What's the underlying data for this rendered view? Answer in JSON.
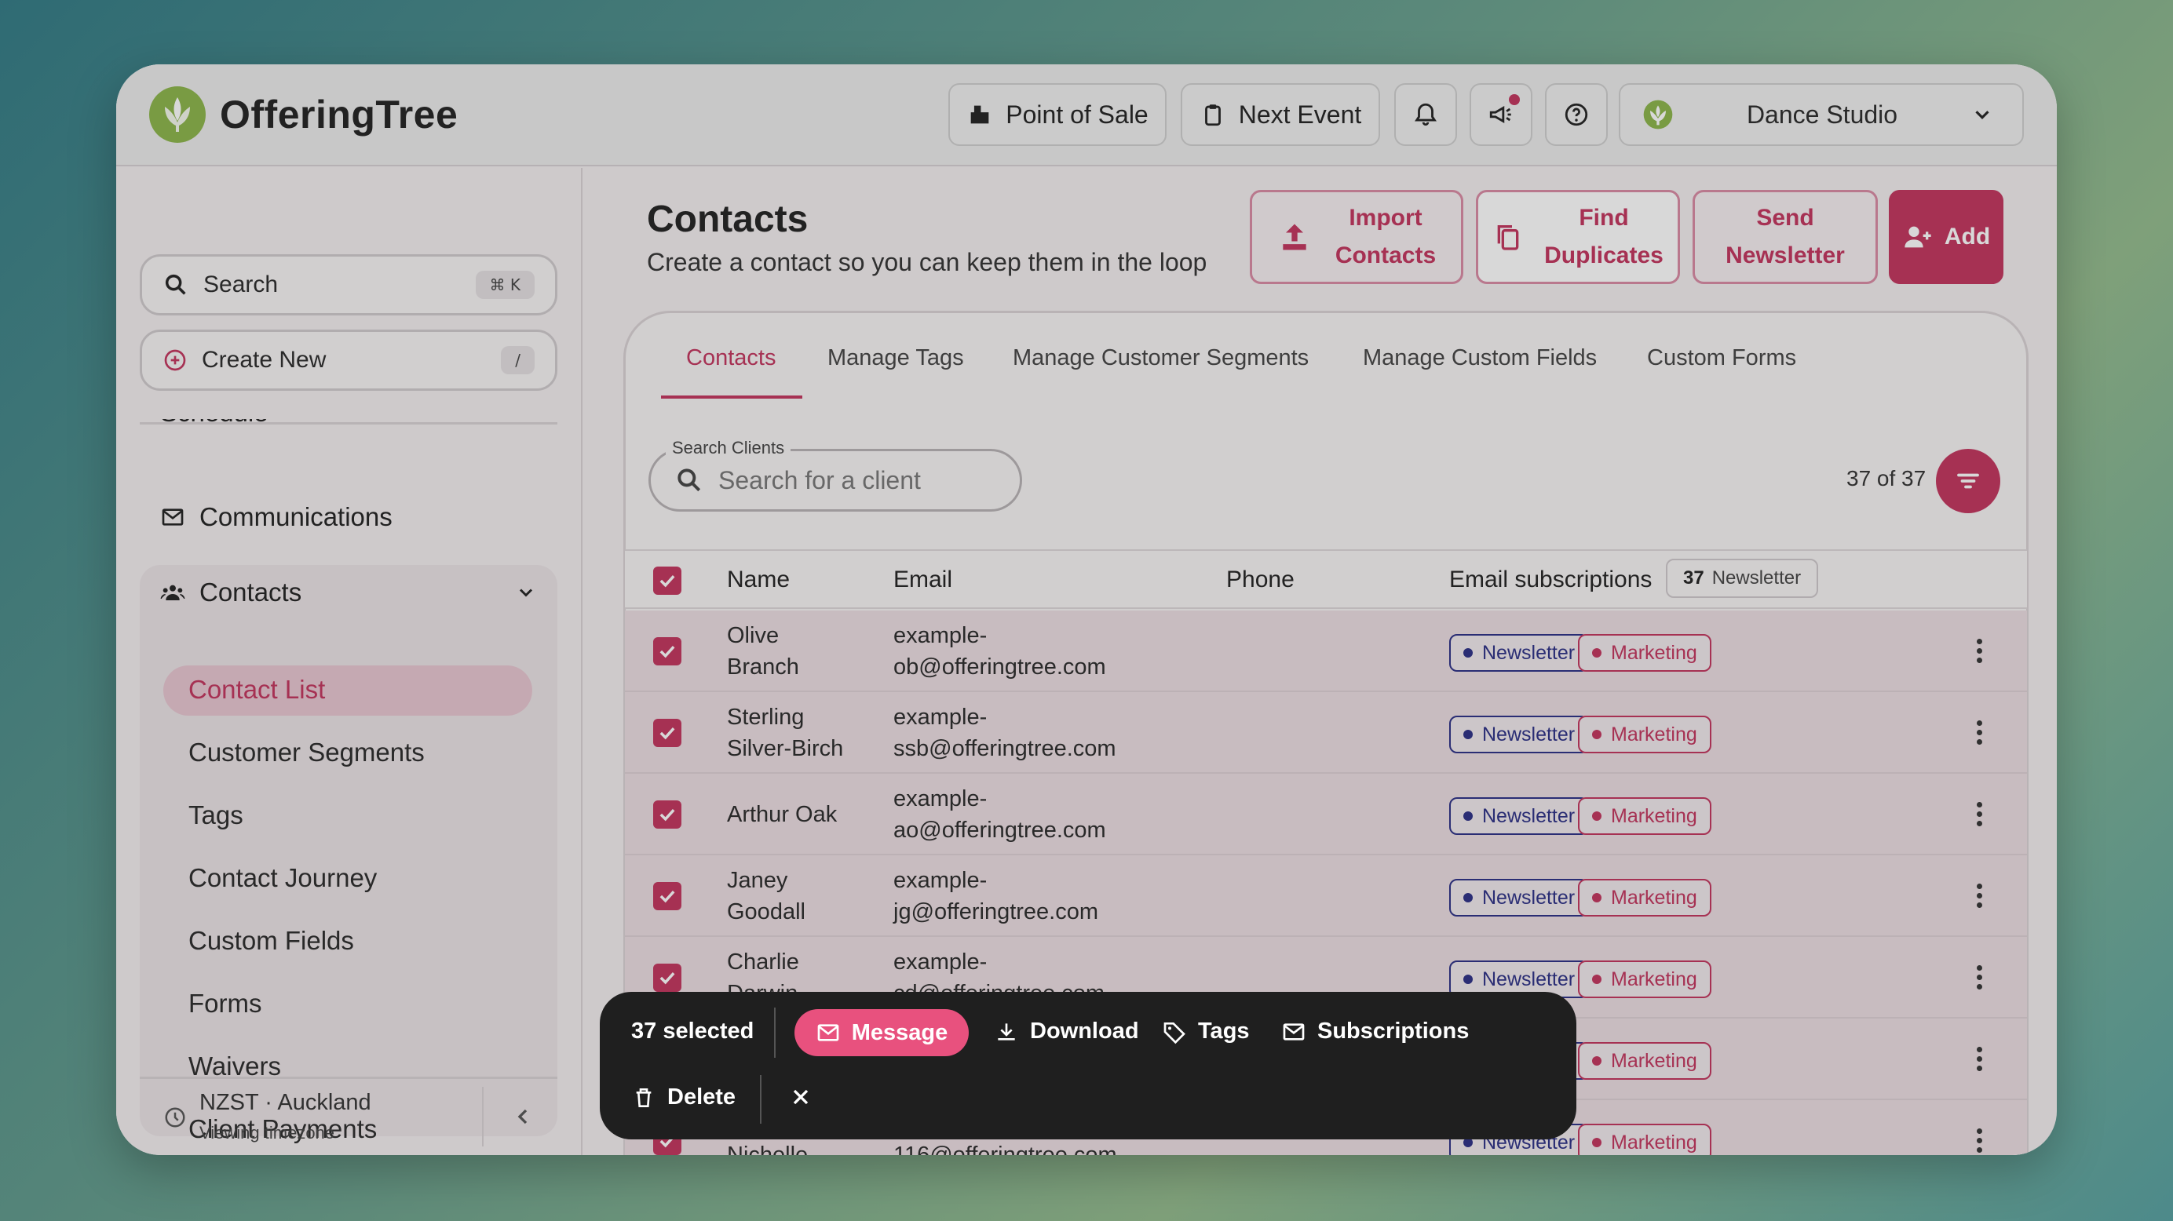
{
  "app": {
    "name": "OfferingTree"
  },
  "topbar": {
    "point_of_sale": "Point of Sale",
    "next_event": "Next Event",
    "studio_name": "Dance Studio"
  },
  "sidebar": {
    "search_label": "Search",
    "search_shortcut": "⌘ K",
    "create_label": "Create New",
    "create_shortcut": "/",
    "schedule_label": "Schedule",
    "communications_label": "Communications",
    "contacts_label": "Contacts",
    "contacts_items": [
      "Contact List",
      "Customer Segments",
      "Tags",
      "Contact Journey",
      "Custom Fields",
      "Forms",
      "Waivers",
      "Client Payments"
    ],
    "timezone": "NZST · Auckland",
    "timezone_caption": "Viewing timezone"
  },
  "main": {
    "title": "Contacts",
    "subtitle": "Create a contact so you can keep them in the loop",
    "actions": {
      "import_line1": "Import",
      "import_line2": "Contacts",
      "find_line1": "Find",
      "find_line2": "Duplicates",
      "send_line1": "Send",
      "send_line2": "Newsletter",
      "add": "Add"
    },
    "tabs": [
      "Contacts",
      "Manage Tags",
      "Manage Customer Segments",
      "Manage Custom Fields",
      "Custom Forms"
    ],
    "search": {
      "label": "Search Clients",
      "placeholder": "Search for a client"
    },
    "count": "37 of 37",
    "columns": {
      "name": "Name",
      "email": "Email",
      "phone": "Phone",
      "subs": "Email subscriptions",
      "subs_count": "37",
      "subs_chip": "Newsletter"
    },
    "rows": [
      {
        "name1": "Olive",
        "name2": "Branch",
        "email1": "example-",
        "email2": "ob@offeringtree.com"
      },
      {
        "name1": "Sterling",
        "name2": "Silver-Birch",
        "email1": "example-",
        "email2": "ssb@offeringtree.com"
      },
      {
        "name1": "Arthur Oak",
        "name2": "",
        "email1": "example-",
        "email2": "ao@offeringtree.com"
      },
      {
        "name1": "Janey",
        "name2": "Goodall",
        "email1": "example-",
        "email2": "jg@offeringtree.com"
      },
      {
        "name1": "Charlie",
        "name2": "Darwin",
        "email1": "example-",
        "email2": "cd@offeringtree.com"
      },
      {
        "name1": "",
        "name2": "",
        "email1": "",
        "email2": ""
      },
      {
        "name1": "Nichelle",
        "name2": "",
        "email1": "116@offeringtree.com",
        "email2": ""
      }
    ],
    "pill_newsletter": "Newsletter",
    "pill_marketing": "Marketing"
  },
  "bulk_bar": {
    "selected": "37 selected",
    "message": "Message",
    "download": "Download",
    "tags": "Tags",
    "subscriptions": "Subscriptions",
    "delete": "Delete"
  },
  "colors": {
    "accent": "#c2345d",
    "newsletter": "#2b2f86",
    "brand_green": "#8bb54a"
  }
}
